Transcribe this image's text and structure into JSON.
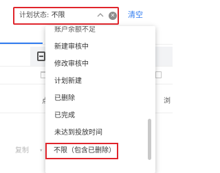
{
  "filter": {
    "label": "计划状态:",
    "value": "不限",
    "clear_link": "清空"
  },
  "background": {
    "col_point": "点击",
    "col_right": "浏",
    "row_copy": "复制"
  },
  "dropdown": {
    "options": [
      "账户余额不足",
      "新建审核中",
      "修改审核中",
      "计划新建",
      "已删除",
      "已完成",
      "未达到投放时间",
      "不限（包含已删除）"
    ],
    "highlighted_option": "不限（包含已删除）"
  },
  "colors": {
    "highlight_border": "#e0242b",
    "link": "#2f7bf0"
  },
  "icons": {
    "select_toggle": "chevron-up-icon",
    "select_clear": "clear-circle-icon",
    "tab": "calendar-icon"
  }
}
